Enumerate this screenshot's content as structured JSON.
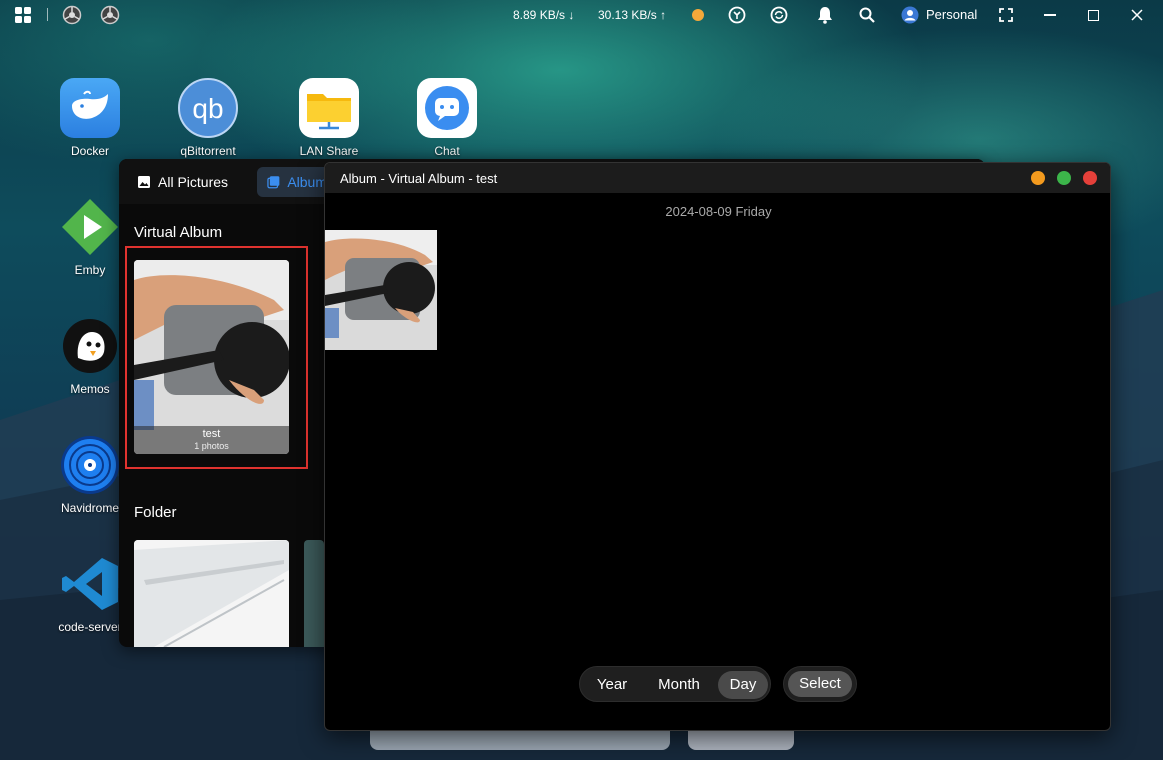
{
  "taskbar": {
    "download_speed": "8.89 KB/s",
    "upload_speed": "30.13 KB/s",
    "user": "Personal"
  },
  "desktop_icons": [
    {
      "label": "Docker"
    },
    {
      "label": "qBittorrent"
    },
    {
      "label": "LAN Share"
    },
    {
      "label": "Chat"
    },
    {
      "label": "Emby"
    },
    {
      "label": "Memos"
    },
    {
      "label": "Navidrome"
    },
    {
      "label": "code-server"
    }
  ],
  "photos_window": {
    "tab_all": "All Pictures",
    "tab_album": "Album",
    "virtual_album_heading": "Virtual Album",
    "album_name": "test",
    "album_count": "1 photos",
    "folder_heading": "Folder"
  },
  "viewer": {
    "title": "Album - Virtual Album - test",
    "date": "2024-08-09 Friday",
    "view_modes": [
      "Year",
      "Month",
      "Day"
    ],
    "active_view": "Day",
    "select_label": "Select"
  },
  "colors": {
    "highlight_border": "#e0332f",
    "accent_blue": "#3b8ef0",
    "dot_orange": "#f39a1e",
    "dot_green": "#3cb54a",
    "dot_red": "#e5403a"
  }
}
